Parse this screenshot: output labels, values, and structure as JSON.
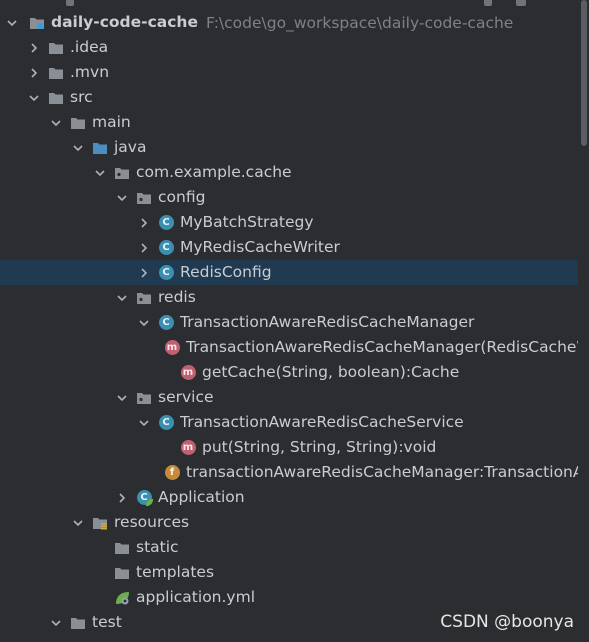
{
  "project_tree": {
    "root": {
      "label": "daily-code-cache",
      "path": "F:\\code\\go_workspace\\daily-code-cache"
    },
    "items": {
      "idea": ".idea",
      "mvn": ".mvn",
      "src": "src",
      "main": "main",
      "java": "java",
      "package": "com.example.cache",
      "config": "config",
      "my_batch_strategy": "MyBatchStrategy",
      "my_redis_cache_writer": "MyRedisCacheWriter",
      "redis_config": "RedisConfig",
      "redis": "redis",
      "tx_manager": "TransactionAwareRedisCacheManager",
      "tx_manager_ctor": "TransactionAwareRedisCacheManager(RedisCacheWriter",
      "get_cache": "getCache(String, boolean):Cache",
      "service": "service",
      "tx_service": "TransactionAwareRedisCacheService",
      "put": "put(String, String, String):void",
      "tx_field": "transactionAwareRedisCacheManager:TransactionAw",
      "application": "Application",
      "resources": "resources",
      "static": "static",
      "templates": "templates",
      "application_yml": "application.yml",
      "test": "test"
    },
    "icon_letters": {
      "class": "C",
      "method": "m",
      "field": "f"
    }
  },
  "watermark": "CSDN @boonya",
  "colors": {
    "background": "#2b2d30",
    "selected_row": "#1f3a51",
    "folder": "#8a8f96",
    "source_folder": "#4a8fc0",
    "class_icon": "#3b8fb0",
    "method_icon": "#c06070",
    "field_icon": "#c58a3e"
  }
}
